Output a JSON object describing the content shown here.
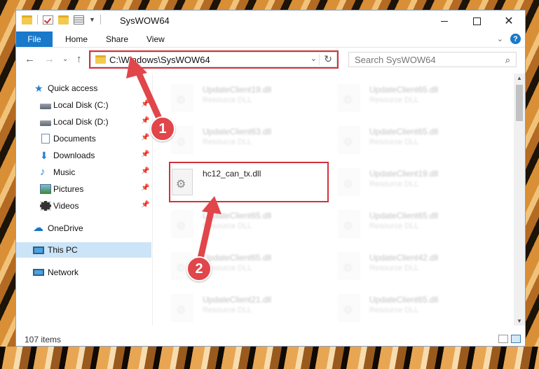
{
  "window": {
    "title": "SysWOW64",
    "close_glyph": "✕"
  },
  "ribbon": {
    "tabs": [
      "File",
      "Home",
      "Share",
      "View"
    ],
    "help_glyph": "?"
  },
  "address": {
    "path": "C:\\Windows\\SysWOW64",
    "search_placeholder": "Search SysWOW64"
  },
  "nav_pane": {
    "items": [
      {
        "label": "Quick access",
        "icon": "star-icon",
        "pinned": false
      },
      {
        "label": "Local Disk (C:)",
        "icon": "drive-icon",
        "pinned": true
      },
      {
        "label": "Local Disk (D:)",
        "icon": "drive-icon",
        "pinned": true
      },
      {
        "label": "Documents",
        "icon": "documents-icon",
        "pinned": true
      },
      {
        "label": "Downloads",
        "icon": "downloads-icon",
        "pinned": true
      },
      {
        "label": "Music",
        "icon": "music-icon",
        "pinned": true
      },
      {
        "label": "Pictures",
        "icon": "pictures-icon",
        "pinned": true
      },
      {
        "label": "Videos",
        "icon": "videos-icon",
        "pinned": true
      },
      {
        "label": "OneDrive",
        "icon": "onedrive-icon",
        "pinned": false
      },
      {
        "label": "This PC",
        "icon": "this-pc-icon",
        "pinned": false,
        "selected": true
      },
      {
        "label": "Network",
        "icon": "network-icon",
        "pinned": false
      }
    ]
  },
  "files": {
    "left": [
      {
        "name": "UpdateClient19.dll",
        "type": "Resource DLL"
      },
      {
        "name": "UpdateClient63.dll",
        "type": "Resource DLL"
      },
      {
        "name": "hc12_can_tx.dll",
        "type": ""
      },
      {
        "name": "UpdateClient65.dll",
        "type": "Resource DLL"
      },
      {
        "name": "UpdateClient65.dll",
        "type": "Resource DLL"
      },
      {
        "name": "UpdateClient21.dll",
        "type": "Resource DLL"
      }
    ],
    "right": [
      {
        "name": "UpdateClient65.dll",
        "type": "Resource DLL"
      },
      {
        "name": "UpdateClient65.dll",
        "type": "Resource DLL"
      },
      {
        "name": "UpdateClient19.dll",
        "type": "Resource DLL"
      },
      {
        "name": "UpdateClient65.dll",
        "type": "Resource DLL"
      },
      {
        "name": "UpdateClient42.dll",
        "type": "Resource DLL"
      },
      {
        "name": "UpdateClient65.dll",
        "type": "Resource DLL"
      }
    ]
  },
  "status": {
    "item_count": "107 items"
  },
  "annotations": {
    "step1": "1",
    "step2": "2",
    "color": "#e0464a"
  }
}
